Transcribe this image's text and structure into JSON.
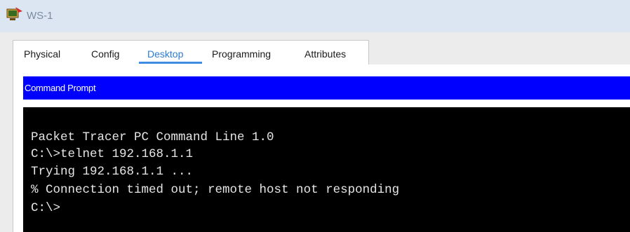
{
  "window": {
    "title": "WS-1"
  },
  "tabs": [
    {
      "label": "Physical",
      "active": false
    },
    {
      "label": "Config",
      "active": false
    },
    {
      "label": "Desktop",
      "active": true
    },
    {
      "label": "Programming",
      "active": false
    },
    {
      "label": "Attributes",
      "active": false
    }
  ],
  "command_prompt": {
    "header": "Command Prompt",
    "lines": [
      "Packet Tracer PC Command Line 1.0",
      "C:\\>telnet 192.168.1.1",
      "Trying 192.168.1.1 ...",
      "% Connection timed out; remote host not responding",
      "C:\\>"
    ]
  },
  "colors": {
    "header_bg": "#0000ff",
    "terminal_bg": "#000000",
    "active_tab": "#2a7bd4",
    "titlebar_bg": "#dbe6f2"
  },
  "icons": [
    "packet-tracer-pc-icon"
  ]
}
